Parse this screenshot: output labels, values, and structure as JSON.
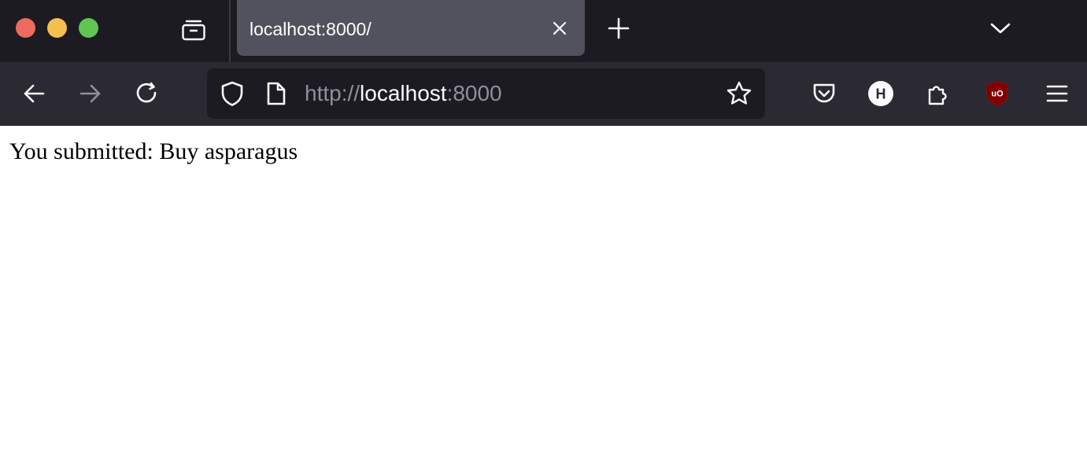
{
  "window": {
    "traffic_lights": {
      "close": "#ed6a5e",
      "minimize": "#f5bf4f",
      "zoom": "#61c554"
    }
  },
  "tabs": {
    "list_icon": "tab-list-icon",
    "items": [
      {
        "title": "localhost:8000/",
        "active": true
      }
    ],
    "new_tab_icon": "plus-icon",
    "overflow_icon": "chevron-down-icon"
  },
  "toolbar": {
    "back_icon": "arrow-left-icon",
    "forward_icon": "arrow-right-icon",
    "reload_icon": "reload-icon",
    "url": {
      "scheme": "http://",
      "host": "localhost",
      "port": ":8000"
    },
    "tracking_protection_icon": "shield-icon",
    "page_info_icon": "page-icon",
    "bookmark_icon": "star-icon",
    "extensions": [
      {
        "name": "pocket-icon"
      },
      {
        "name": "h-extension-icon",
        "letter": "H"
      },
      {
        "name": "puzzle-icon"
      },
      {
        "name": "ublock-icon",
        "letter": "uO",
        "color": "#800000"
      }
    ],
    "menu_icon": "hamburger-menu-icon"
  },
  "page": {
    "message": "You submitted: Buy asparagus"
  }
}
